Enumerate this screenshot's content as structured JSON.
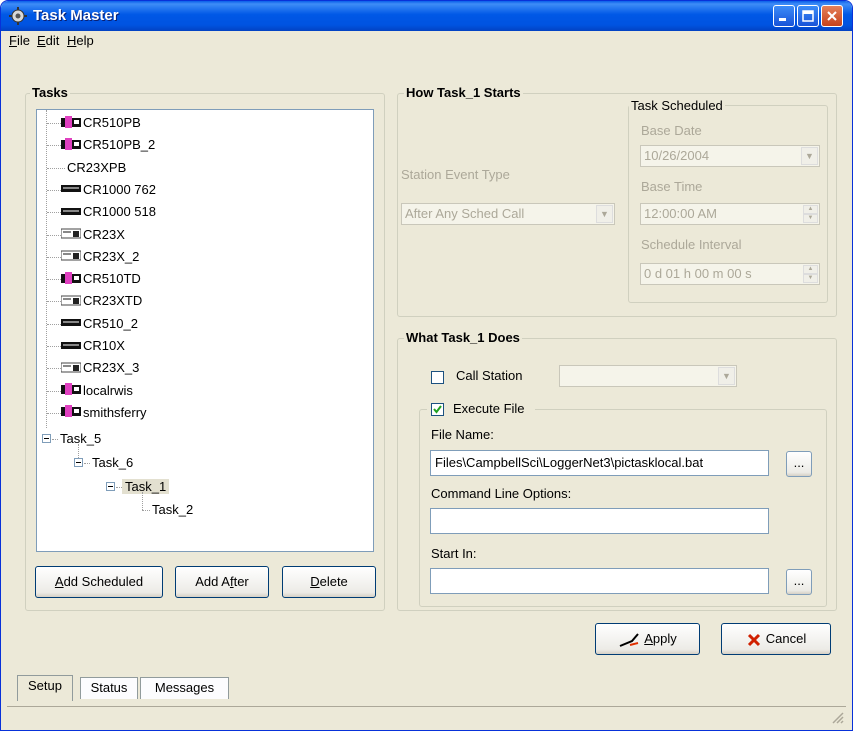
{
  "window": {
    "title": "Task Master"
  },
  "menu": {
    "file": "File",
    "file_key": "F",
    "file_rest": "ile",
    "edit": "Edit",
    "edit_key": "E",
    "edit_rest": "dit",
    "help": "Help",
    "help_key": "H",
    "help_rest": "elp"
  },
  "tasks_group": {
    "label": "Tasks"
  },
  "tree": {
    "stations": [
      {
        "label": "CR510PB",
        "icon": "datalogger-pink-icon"
      },
      {
        "label": "CR510PB_2",
        "icon": "datalogger-pink-icon"
      },
      {
        "label": "CR23XPB",
        "icon": ""
      },
      {
        "label": "CR1000 762",
        "icon": "datalogger-black-icon"
      },
      {
        "label": "CR1000 518",
        "icon": "datalogger-black-icon"
      },
      {
        "label": "CR23X",
        "icon": "datalogger-grey-icon"
      },
      {
        "label": "CR23X_2",
        "icon": "datalogger-grey-icon"
      },
      {
        "label": "CR510TD",
        "icon": "datalogger-pink-icon"
      },
      {
        "label": "CR23XTD",
        "icon": "datalogger-grey-icon"
      },
      {
        "label": "CR510_2",
        "icon": "datalogger-black-icon"
      },
      {
        "label": "CR10X",
        "icon": "datalogger-black-icon"
      },
      {
        "label": "CR23X_3",
        "icon": "datalogger-grey-icon"
      },
      {
        "label": "localrwis",
        "icon": "datalogger-pink-icon"
      },
      {
        "label": "smithsferry",
        "icon": "datalogger-pink-icon"
      }
    ],
    "task5": "Task_5",
    "task6": "Task_6",
    "task1": "Task_1",
    "task2": "Task_2"
  },
  "buttons": {
    "add_scheduled_key": "A",
    "add_scheduled_rest": "dd Scheduled",
    "add_after_pre": "Add A",
    "add_after_key": "f",
    "add_after_rest": "ter",
    "delete_key": "D",
    "delete_rest": "elete",
    "apply_key": "A",
    "apply_rest": "pply",
    "cancel": "Cancel"
  },
  "how_starts": {
    "label": "How Task_1 Starts",
    "station_event_type_label": "Station Event Type",
    "station_event_type_value": "After Any Sched Call",
    "scheduled_label": "Task Scheduled",
    "base_date_label": "Base Date",
    "base_date_value": "10/26/2004",
    "base_time_label": "Base Time",
    "base_time_value": "12:00:00 AM",
    "interval_label": "Schedule Interval",
    "interval_value": "0 d 01 h 00 m 00 s"
  },
  "what_does": {
    "label": "What Task_1 Does",
    "call_station_label": "Call Station",
    "call_station_checked": false,
    "execute_file_label": "Execute File",
    "execute_file_checked": true,
    "file_name_label": "File Name:",
    "file_name_value": "Files\\CampbellSci\\LoggerNet3\\pictasklocal.bat",
    "cmd_options_label": "Command Line Options:",
    "cmd_options_value": "",
    "start_in_label": "Start In:",
    "start_in_value": "",
    "ellipsis": "..."
  },
  "tabs": [
    "Setup",
    "Status",
    "Messages"
  ],
  "colors": {
    "titlebar": "#0058E6",
    "face": "#ECE9D8",
    "accent_pink": "#E040C0"
  }
}
